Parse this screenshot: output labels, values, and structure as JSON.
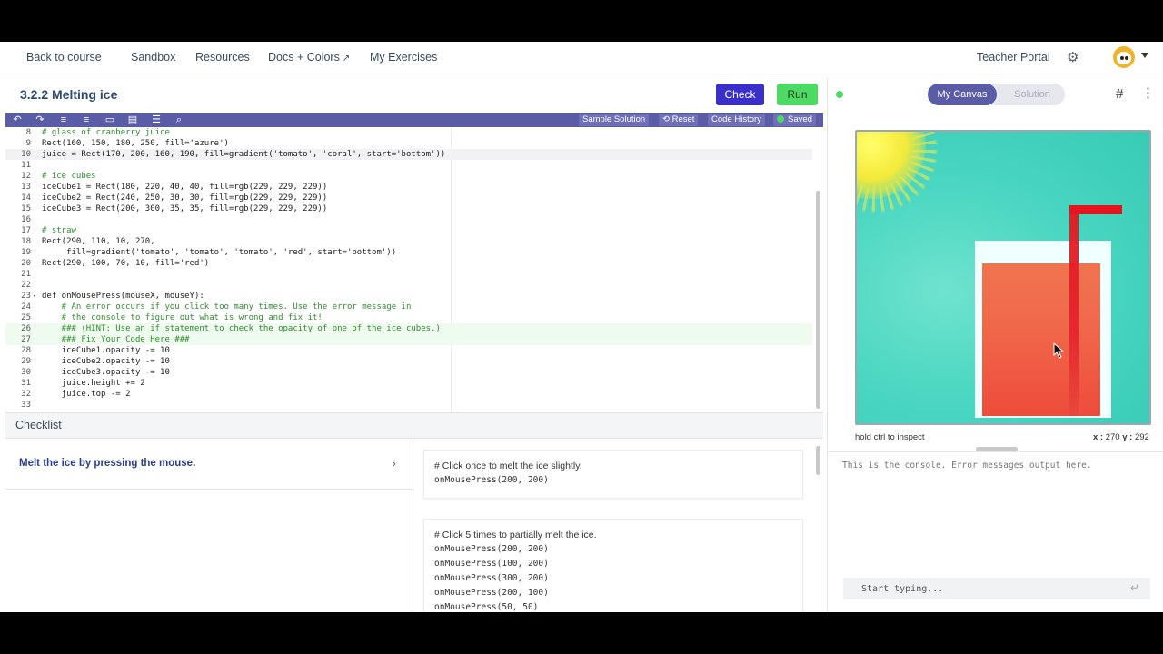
{
  "nav": {
    "back": "Back to course",
    "sandbox": "Sandbox",
    "resources": "Resources",
    "docs": "Docs + Colors",
    "exercises": "My Exercises",
    "teacher": "Teacher Portal",
    "docs_icon": "external-link-icon",
    "settings_icon": "gear-icon"
  },
  "editor_header": {
    "title": "3.2.2 Melting ice",
    "check": "Check",
    "run": "Run"
  },
  "toolbar": {
    "icons": [
      "undo-icon",
      "redo-icon",
      "indent-icon",
      "outdent-icon",
      "comment-icon",
      "list-icon",
      "format-icon",
      "search-icon"
    ],
    "sample_solution": "Sample Solution",
    "reset": "⟲ Reset",
    "code_history": "Code History",
    "saved": "Saved"
  },
  "code": [
    {
      "n": "8",
      "t": "# glass of cranberry juice"
    },
    {
      "n": "9",
      "t": "Rect(160, 150, 180, 250, fill='azure')"
    },
    {
      "n": "10",
      "t": "juice = Rect(170, 200, 160, 190, fill=gradient('tomato', 'coral', start='bottom'))"
    },
    {
      "n": "11",
      "t": ""
    },
    {
      "n": "12",
      "t": "# ice cubes"
    },
    {
      "n": "13",
      "t": "iceCube1 = Rect(180, 220, 40, 40, fill=rgb(229, 229, 229))"
    },
    {
      "n": "14",
      "t": "iceCube2 = Rect(240, 250, 30, 30, fill=rgb(229, 229, 229))"
    },
    {
      "n": "15",
      "t": "iceCube3 = Rect(200, 300, 35, 35, fill=rgb(229, 229, 229))"
    },
    {
      "n": "16",
      "t": ""
    },
    {
      "n": "17",
      "t": "# straw"
    },
    {
      "n": "18",
      "t": "Rect(290, 110, 10, 270,"
    },
    {
      "n": "19",
      "t": "     fill=gradient('tomato', 'tomato', 'tomato', 'red', start='bottom'))"
    },
    {
      "n": "20",
      "t": "Rect(290, 100, 70, 10, fill='red')"
    },
    {
      "n": "21",
      "t": ""
    },
    {
      "n": "22",
      "t": ""
    },
    {
      "n": "23",
      "t": "def onMousePress(mouseX, mouseY):"
    },
    {
      "n": "24",
      "t": "    # An error occurs if you click too many times. Use the error message in"
    },
    {
      "n": "25",
      "t": "    # the console to figure out what is wrong and fix it!"
    },
    {
      "n": "26",
      "t": "    ### (HINT: Use an if statement to check the opacity of one of the ice cubes.)"
    },
    {
      "n": "27",
      "t": "    ### Fix Your Code Here ###"
    },
    {
      "n": "28",
      "t": "    iceCube1.opacity -= 10"
    },
    {
      "n": "29",
      "t": "    iceCube2.opacity -= 10"
    },
    {
      "n": "30",
      "t": "    iceCube3.opacity -= 10"
    },
    {
      "n": "31",
      "t": "    juice.height += 2"
    },
    {
      "n": "32",
      "t": "    juice.top -= 2"
    },
    {
      "n": "33",
      "t": ""
    }
  ],
  "checklist": {
    "tab": "Checklist",
    "item": "Melt the ice by pressing the mouse.",
    "cards": [
      {
        "lines": [
          "# Click once to melt the ice slightly.",
          "onMousePress(200, 200)"
        ]
      },
      {
        "lines": [
          "# Click 5 times to partially melt the ice.",
          "onMousePress(200, 200)",
          "onMousePress(100, 200)",
          "onMousePress(300, 200)",
          "onMousePress(200, 100)",
          "onMousePress(50, 50)"
        ]
      }
    ]
  },
  "canvas_panel": {
    "my_canvas": "My Canvas",
    "solution": "Solution",
    "inspect_hint": "hold ctrl to inspect",
    "x_label": "x :",
    "x_value": "270",
    "y_label": "y :",
    "y_value": "292",
    "console_msg": "This is the console. Error messages output here.",
    "console_placeholder": "Start typing..."
  },
  "colors": {
    "accent": "#5b5ca6",
    "check": "#3b2fc9",
    "run": "#4cd964",
    "sky": "#4ed8c5",
    "glass": "#f0ffff",
    "juice_bottom": "#ff6347",
    "juice_top": "#ff7f50",
    "straw": "#ff0000"
  }
}
